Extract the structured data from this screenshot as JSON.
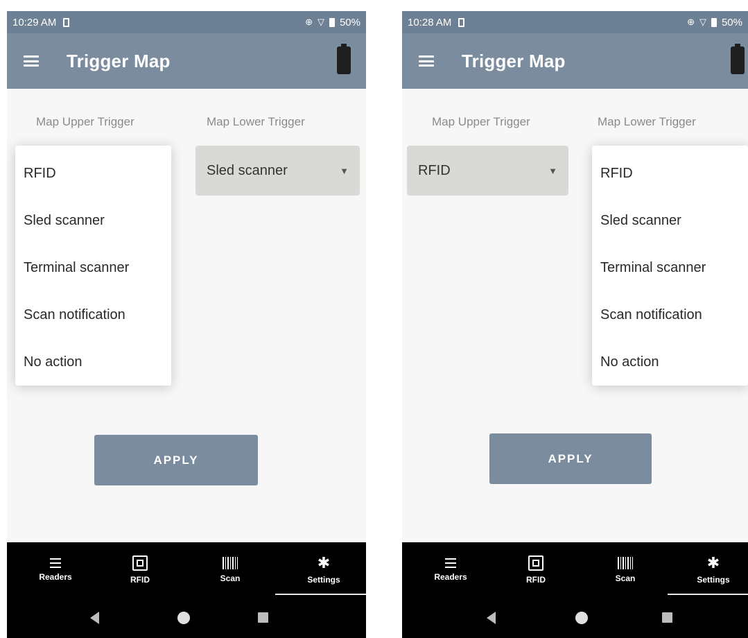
{
  "screens": [
    {
      "status": {
        "time": "10:29 AM",
        "battery": "50%"
      },
      "appbar": {
        "title": "Trigger Map"
      },
      "upper_label": "Map Upper Trigger",
      "lower_label": "Map Lower Trigger",
      "lower_value": "Sled scanner",
      "dropdown_items": [
        "RFID",
        "Sled scanner",
        "Terminal scanner",
        "Scan notification",
        "No action"
      ],
      "apply_label": "APPLY",
      "nav": [
        "Readers",
        "RFID",
        "Scan",
        "Settings"
      ]
    },
    {
      "status": {
        "time": "10:28 AM",
        "battery": "50%"
      },
      "appbar": {
        "title": "Trigger Map"
      },
      "upper_label": "Map Upper Trigger",
      "lower_label": "Map Lower Trigger",
      "upper_value": "RFID",
      "dropdown_items": [
        "RFID",
        "Sled scanner",
        "Terminal scanner",
        "Scan notification",
        "No action"
      ],
      "apply_label": "APPLY",
      "nav": [
        "Readers",
        "RFID",
        "Scan",
        "Settings"
      ]
    }
  ],
  "colors": {
    "appbar": "#7a8c9e",
    "statusbar": "#6d8094",
    "select": "#d9d9d6",
    "nav": "#000000"
  },
  "icons": [
    "menu-icon",
    "battery-icon",
    "dropdown-caret-icon",
    "list-icon",
    "rfid-icon",
    "barcode-icon",
    "gear-icon"
  ]
}
